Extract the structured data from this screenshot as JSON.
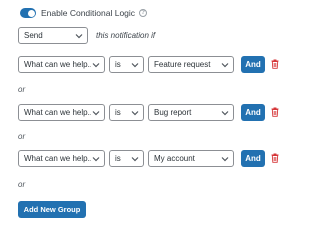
{
  "logic": {
    "toggle_label": "Enable Conditional Logic",
    "enabled": true,
    "help_glyph": "?"
  },
  "action": {
    "selected": "Send",
    "suffix": "this notification if"
  },
  "rules": [
    {
      "field": "What can we help...",
      "operator": "is",
      "value": "Feature request",
      "and_label": "And"
    },
    {
      "field": "What can we help...",
      "operator": "is",
      "value": "Bug report",
      "and_label": "And"
    },
    {
      "field": "What can we help...",
      "operator": "is",
      "value": "My account",
      "and_label": "And"
    }
  ],
  "or_label": "or",
  "add_group_label": "Add New Group",
  "colors": {
    "accent": "#2271b1",
    "danger": "#d63638",
    "border": "#8c8f94"
  }
}
